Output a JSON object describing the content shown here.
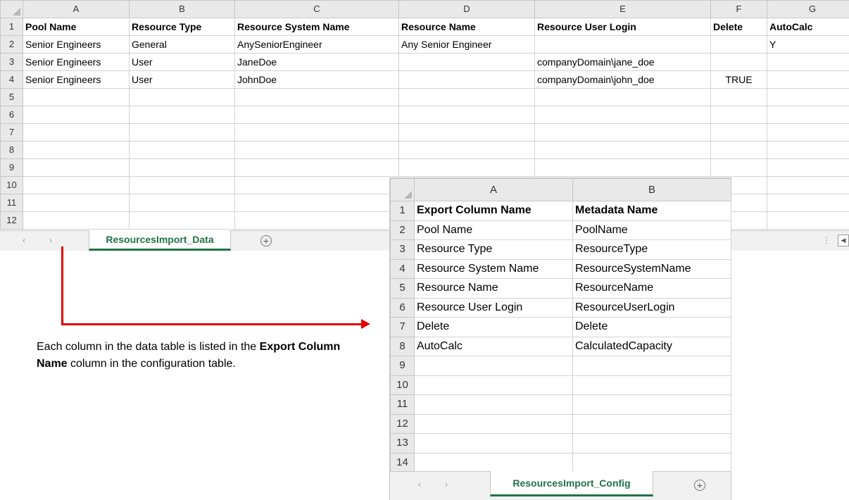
{
  "data_sheet": {
    "column_letters": [
      "A",
      "B",
      "C",
      "D",
      "E",
      "F",
      "G"
    ],
    "row_numbers": [
      "1",
      "2",
      "3",
      "4",
      "5",
      "6",
      "7",
      "8",
      "9",
      "10",
      "11",
      "12"
    ],
    "rows": [
      [
        "Pool Name",
        "Resource Type",
        "Resource System Name",
        "Resource Name",
        "Resource User Login",
        "Delete",
        "AutoCalc"
      ],
      [
        "Senior Engineers",
        "General",
        "AnySeniorEngineer",
        "Any Senior Engineer",
        "",
        "",
        "Y"
      ],
      [
        "Senior Engineers",
        "User",
        "JaneDoe",
        "",
        "companyDomain\\jane_doe",
        "",
        ""
      ],
      [
        "Senior Engineers",
        "User",
        "JohnDoe",
        "",
        "companyDomain\\john_doe",
        "TRUE",
        ""
      ],
      [
        "",
        "",
        "",
        "",
        "",
        "",
        ""
      ],
      [
        "",
        "",
        "",
        "",
        "",
        "",
        ""
      ],
      [
        "",
        "",
        "",
        "",
        "",
        "",
        ""
      ],
      [
        "",
        "",
        "",
        "",
        "",
        "",
        ""
      ],
      [
        "",
        "",
        "",
        "",
        "",
        "",
        ""
      ],
      [
        "",
        "",
        "",
        "",
        "",
        "",
        ""
      ],
      [
        "",
        "",
        "",
        "",
        "",
        "",
        ""
      ],
      [
        "",
        "",
        "",
        "",
        "",
        "",
        ""
      ]
    ],
    "tab_label": "ResourcesImport_Data"
  },
  "config_sheet": {
    "column_letters": [
      "A",
      "B"
    ],
    "row_numbers": [
      "1",
      "2",
      "3",
      "4",
      "5",
      "6",
      "7",
      "8",
      "9",
      "10",
      "11",
      "12",
      "13",
      "14"
    ],
    "rows": [
      [
        "Export Column Name",
        "Metadata Name"
      ],
      [
        "Pool Name",
        "PoolName"
      ],
      [
        "Resource Type",
        "ResourceType"
      ],
      [
        "Resource System Name",
        "ResourceSystemName"
      ],
      [
        "Resource Name",
        "ResourceName"
      ],
      [
        "Resource User Login",
        "ResourceUserLogin"
      ],
      [
        "Delete",
        "Delete"
      ],
      [
        "AutoCalc",
        "CalculatedCapacity"
      ],
      [
        "",
        ""
      ],
      [
        "",
        ""
      ],
      [
        "",
        ""
      ],
      [
        "",
        ""
      ],
      [
        "",
        ""
      ],
      [
        "",
        ""
      ]
    ],
    "tab_label": "ResourcesImport_Config"
  },
  "caption": {
    "part1": "Each column in the data table is listed in the ",
    "bold": "Export Column Name",
    "part2": " column in the configuration table."
  },
  "icons": {
    "add_sheet": "plus-circle-icon",
    "nav_prev": "chevron-left-icon",
    "nav_next": "chevron-right-icon",
    "arrow": "red-elbow-arrow"
  },
  "colors": {
    "tab_accent": "#217346",
    "arrow": "#e60000"
  }
}
